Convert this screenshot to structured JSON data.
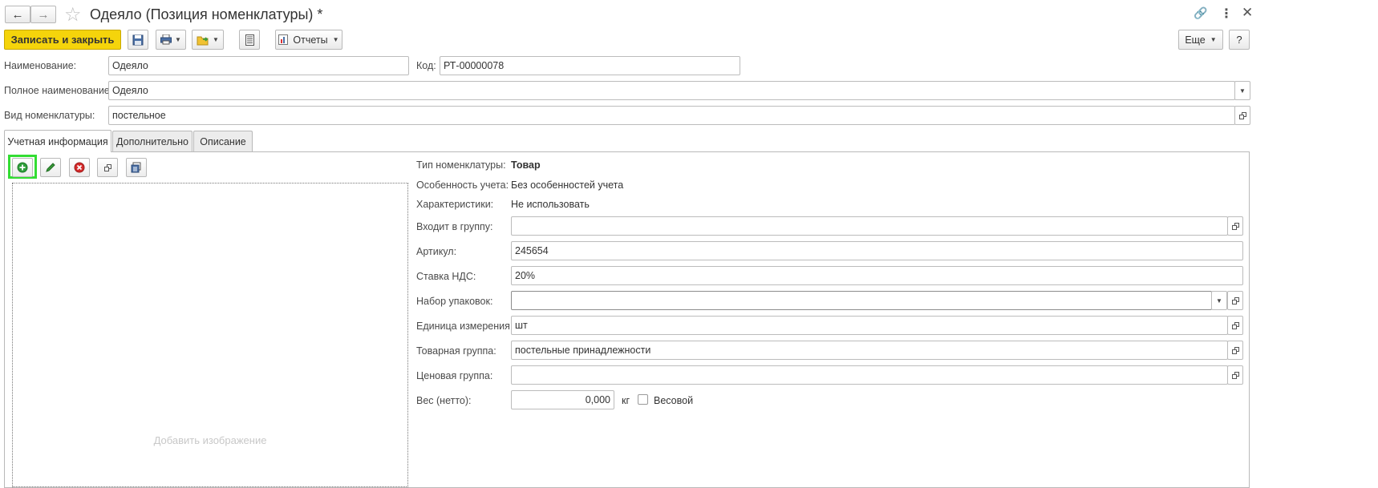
{
  "window": {
    "title": "Одеяло (Позиция номенклатуры) *",
    "back_label": "←",
    "forward_label": "→",
    "favorite_icon": "star-icon",
    "link_icon": "link-icon",
    "menu_icon": "more-vertical-icon",
    "close_icon": "close-icon"
  },
  "toolbar": {
    "save_close_label": "Записать и закрыть",
    "reports_label": "Отчеты",
    "more_label": "Еще",
    "help_label": "?"
  },
  "form": {
    "name_label": "Наименование:",
    "name_value": "Одеяло",
    "code_label": "Код:",
    "code_value": "РТ-00000078",
    "full_name_label": "Полное наименование:",
    "full_name_value": "Одеяло",
    "kind_label": "Вид номенклатуры:",
    "kind_value": "постельное"
  },
  "tabs": [
    {
      "label": "Учетная информация",
      "active": true
    },
    {
      "label": "Дополнительно",
      "active": false
    },
    {
      "label": "Описание",
      "active": false
    }
  ],
  "image_panel": {
    "placeholder": "Добавить изображение"
  },
  "details": {
    "type_label": "Тип номенклатуры:",
    "type_value": "Товар",
    "feature_label": "Особенность учета:",
    "feature_value": "Без особенностей учета",
    "characteristics_label": "Характеристики:",
    "characteristics_value": "Не использовать",
    "group_label": "Входит в группу:",
    "group_value": "",
    "article_label": "Артикул:",
    "article_value": "245654",
    "vat_label": "Ставка НДС:",
    "vat_value": "20%",
    "packages_label": "Набор упаковок:",
    "packages_value": "",
    "unit_label": "Единица измерения:",
    "unit_value": "шт",
    "goods_group_label": "Товарная группа:",
    "goods_group_value": "постельные принадлежности",
    "price_group_label": "Ценовая группа:",
    "price_group_value": "",
    "weight_label": "Вес (нетто):",
    "weight_value": "0,000",
    "weight_unit": "кг",
    "weighted_label": "Весовой"
  }
}
